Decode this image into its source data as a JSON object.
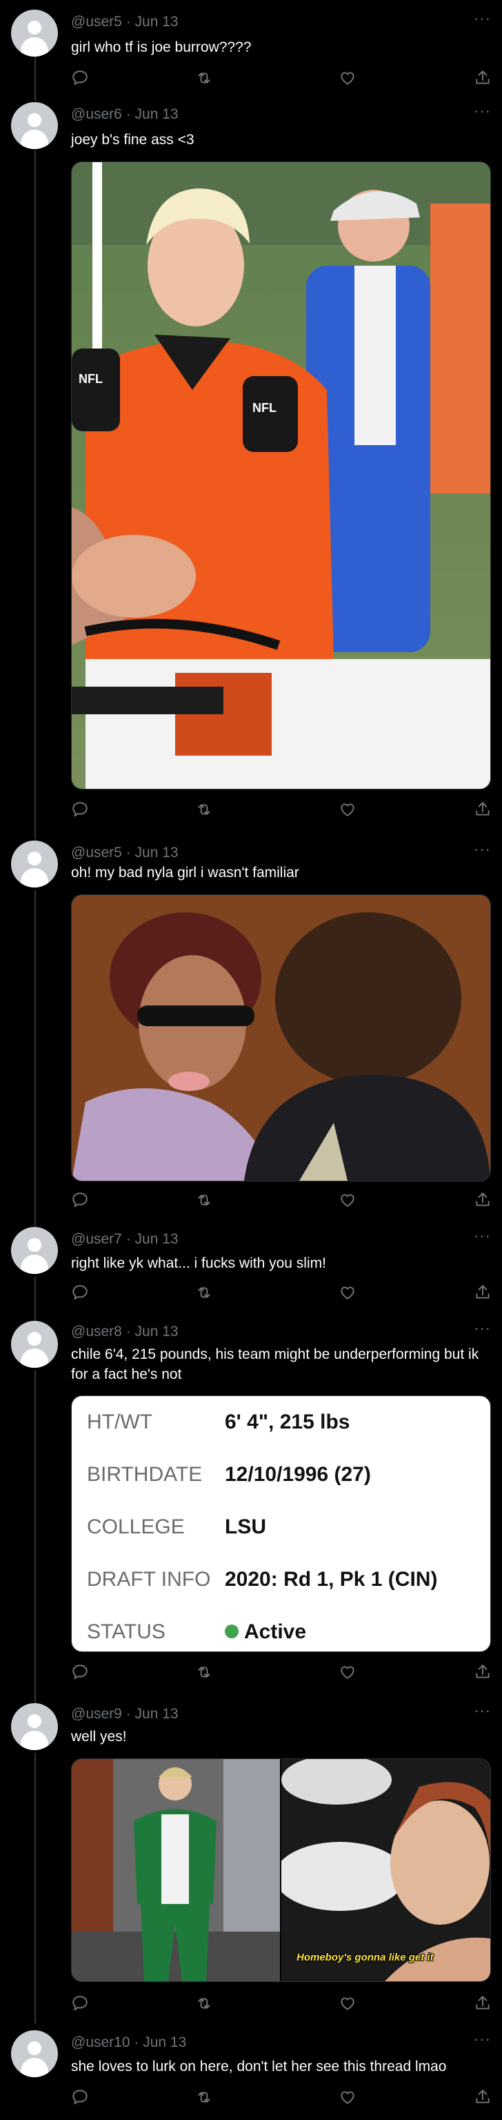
{
  "posts": [
    {
      "user": "@user5",
      "date": "Jun 13",
      "text": "girl who tf is joe burrow????"
    },
    {
      "user": "@user6",
      "date": "Jun 13",
      "text": "joey b's fine ass <3"
    },
    {
      "user": "@user5",
      "date": "Jun 13",
      "text": "oh! my bad nyla girl i wasn't familiar"
    },
    {
      "user": "@user7",
      "date": "Jun 13",
      "text": "right like yk what... i fucks with you slim!"
    },
    {
      "user": "@user8",
      "date": "Jun 13",
      "text": "chile 6'4, 215 pounds, his team might be underperforming but ik for a fact he's not"
    },
    {
      "user": "@user9",
      "date": "Jun 13",
      "text": "well yes!"
    },
    {
      "user": "@user10",
      "date": "Jun 13",
      "text": "she loves to lurk on here, don't let her see this thread lmao"
    }
  ],
  "separator": "·",
  "more_glyph": "···",
  "stats_card": {
    "rows": [
      {
        "label": "HT/WT",
        "value": "6' 4\", 215 lbs"
      },
      {
        "label": "BIRTHDATE",
        "value": "12/10/1996 (27)"
      },
      {
        "label": "COLLEGE",
        "value": "LSU"
      },
      {
        "label": "DRAFT INFO",
        "value": "2020: Rd 1, Pk 1 (CIN)"
      },
      {
        "label": "STATUS",
        "value": "Active"
      }
    ],
    "status_color": "#3fa34d"
  },
  "gif_caption": "Homeboy's gonna like get it",
  "photo_logos": {
    "left": "NFL",
    "right": "NFL"
  },
  "icons": [
    "reply-icon",
    "retweet-icon",
    "like-icon",
    "share-icon"
  ],
  "colors": {
    "background": "#000000",
    "text": "#ffffff",
    "muted": "#71767b",
    "thread_line": "#333639"
  }
}
